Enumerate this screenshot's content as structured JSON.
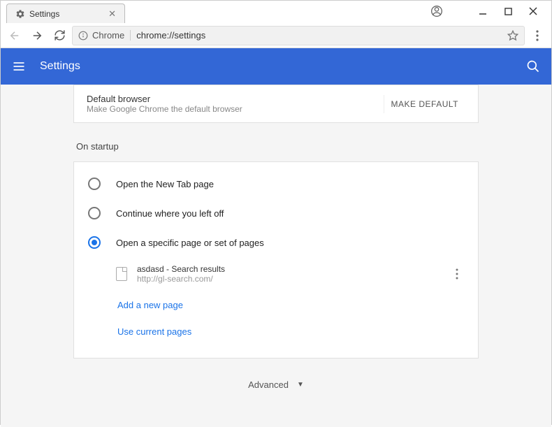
{
  "window": {
    "tab_title": "Settings"
  },
  "toolbar": {
    "protocol_label": "Chrome",
    "url": "chrome://settings"
  },
  "header": {
    "title": "Settings"
  },
  "default_browser": {
    "title": "Default browser",
    "subtitle": "Make Google Chrome the default browser",
    "button": "MAKE DEFAULT"
  },
  "startup": {
    "section_title": "On startup",
    "options": [
      {
        "label": "Open the New Tab page"
      },
      {
        "label": "Continue where you left off"
      },
      {
        "label": "Open a specific page or set of pages"
      }
    ],
    "pages": [
      {
        "title": "asdasd - Search results",
        "url": "http://gl-search.com/"
      }
    ],
    "add_page_link": "Add a new page",
    "use_current_link": "Use current pages"
  },
  "advanced": {
    "label": "Advanced"
  }
}
